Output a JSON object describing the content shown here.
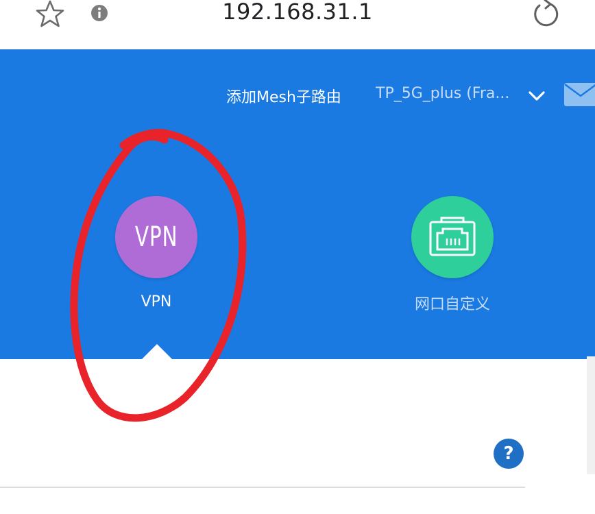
{
  "browser": {
    "url": "192.168.31.1",
    "icons": [
      "star-icon",
      "info-icon",
      "reload-icon"
    ]
  },
  "header": {
    "add_mesh_label": "添加Mesh子路由",
    "network_name": "TP_5G_plus (Fra...",
    "icons": [
      "chevron-down-icon",
      "mail-icon",
      "ethernet-port-icon"
    ],
    "colors": {
      "header_bg": "#1a7ae2",
      "vpn_circle": "#b06cd6",
      "port_circle": "#2fcf9b",
      "help_button": "#1f6fc4",
      "annotation": "#e8232a"
    }
  },
  "apps": {
    "vpn": {
      "icon_text": "VPN",
      "label": "VPN"
    },
    "port_custom": {
      "label": "网口自定义"
    }
  },
  "content": {
    "help_label": "?"
  }
}
